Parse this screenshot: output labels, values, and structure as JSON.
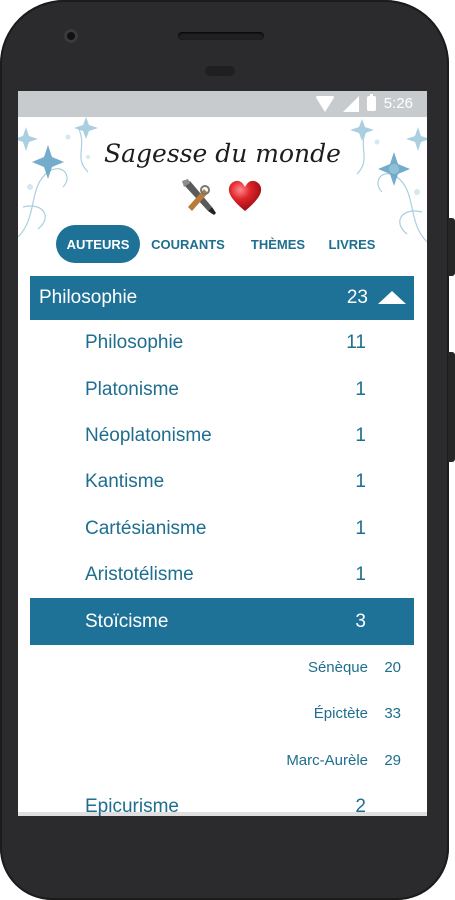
{
  "status_bar": {
    "time": "5:26"
  },
  "header": {
    "title": "Sagesse du monde"
  },
  "tabs": [
    {
      "label": "AUTEURS",
      "active": true
    },
    {
      "label": "COURANTS",
      "active": false
    },
    {
      "label": "THÈMES",
      "active": false
    },
    {
      "label": "LIVRES",
      "active": false
    }
  ],
  "group": {
    "label": "Philosophie",
    "count": "23"
  },
  "items": [
    {
      "label": "Philosophie",
      "count": "11"
    },
    {
      "label": "Platonisme",
      "count": "1"
    },
    {
      "label": "Néoplatonisme",
      "count": "1"
    },
    {
      "label": "Kantisme",
      "count": "1"
    },
    {
      "label": "Cartésianisme",
      "count": "1"
    },
    {
      "label": "Aristotélisme",
      "count": "1"
    },
    {
      "label": "Stoïcisme",
      "count": "3",
      "selected": true
    }
  ],
  "subitems": [
    {
      "label": "Sénèque",
      "count": "20"
    },
    {
      "label": "Épictète",
      "count": "33"
    },
    {
      "label": "Marc-Aurèle",
      "count": "29"
    }
  ],
  "next_item": {
    "label": "Epicurisme",
    "count": "2"
  },
  "colors": {
    "accent": "#1e7297",
    "text": "#1e6e8f",
    "heart": "#e0252a"
  },
  "icons": [
    "wifi-icon",
    "signal-icon",
    "battery-icon",
    "tools-icon",
    "heart-icon",
    "caret-up-icon"
  ]
}
